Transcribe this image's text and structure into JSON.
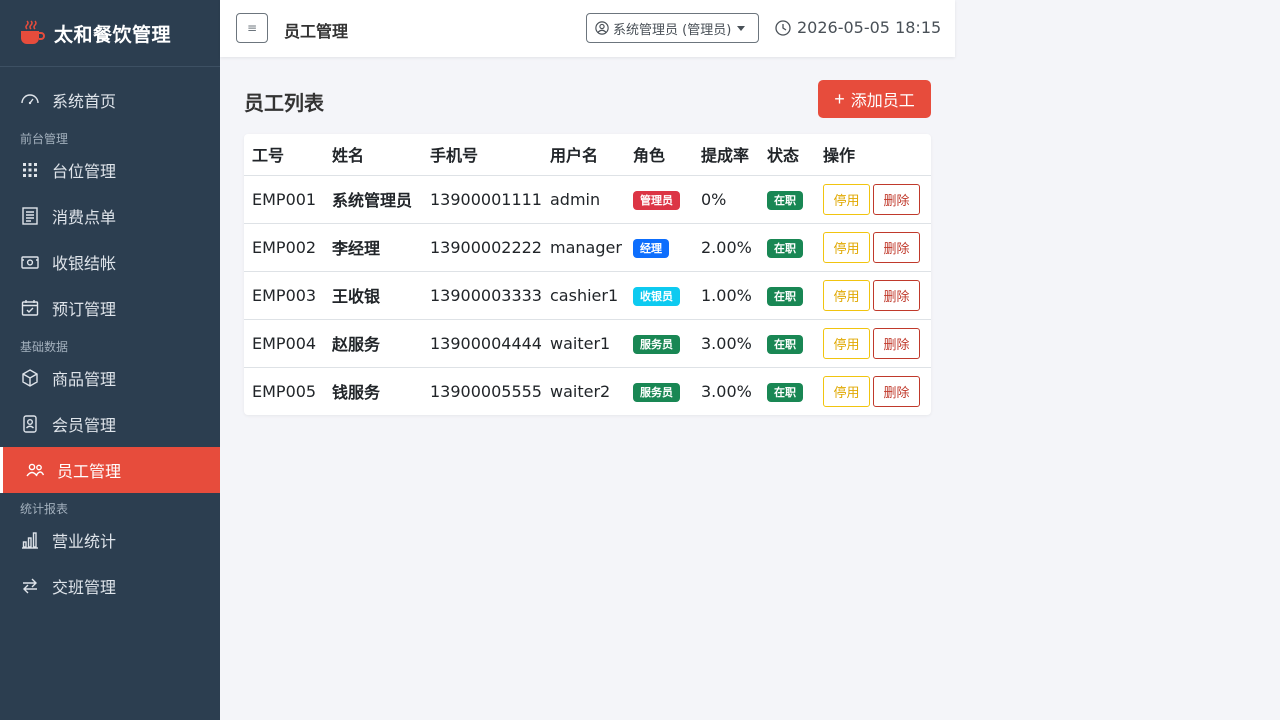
{
  "app": {
    "title": "太和餐饮管理"
  },
  "sidebar": {
    "items": [
      {
        "type": "item",
        "label": "系统首页",
        "icon": "dashboard-icon",
        "active": false
      },
      {
        "type": "section",
        "label": "前台管理"
      },
      {
        "type": "item",
        "label": "台位管理",
        "icon": "grid-icon",
        "active": false
      },
      {
        "type": "item",
        "label": "消费点单",
        "icon": "receipt-icon",
        "active": false
      },
      {
        "type": "item",
        "label": "收银结帐",
        "icon": "cash-icon",
        "active": false
      },
      {
        "type": "item",
        "label": "预订管理",
        "icon": "calendar-check-icon",
        "active": false
      },
      {
        "type": "section",
        "label": "基础数据"
      },
      {
        "type": "item",
        "label": "商品管理",
        "icon": "box-icon",
        "active": false
      },
      {
        "type": "item",
        "label": "会员管理",
        "icon": "member-card-icon",
        "active": false
      },
      {
        "type": "item",
        "label": "员工管理",
        "icon": "people-icon",
        "active": true
      },
      {
        "type": "section",
        "label": "统计报表"
      },
      {
        "type": "item",
        "label": "营业统计",
        "icon": "bar-chart-icon",
        "active": false
      },
      {
        "type": "item",
        "label": "交班管理",
        "icon": "swap-icon",
        "active": false
      }
    ]
  },
  "header": {
    "toggle_label": "≡",
    "page_title": "员工管理",
    "user_label": "系统管理员 (管理员)",
    "datetime": "2026-05-05 18:15"
  },
  "main": {
    "title": "员工列表",
    "add_button": "添加员工",
    "columns": [
      "工号",
      "姓名",
      "手机号",
      "用户名",
      "角色",
      "提成率",
      "状态",
      "操作"
    ],
    "rows": [
      {
        "id": "EMP001",
        "name": "系统管理员",
        "phone": "13900001111",
        "username": "admin",
        "role": "管理员",
        "role_color": "#dc3545",
        "commission": "0%",
        "status": "在职",
        "btn_disable": "停用",
        "btn_delete": "删除"
      },
      {
        "id": "EMP002",
        "name": "李经理",
        "phone": "13900002222",
        "username": "manager",
        "role": "经理",
        "role_color": "#0d6efd",
        "commission": "2.00%",
        "status": "在职",
        "btn_disable": "停用",
        "btn_delete": "删除"
      },
      {
        "id": "EMP003",
        "name": "王收银",
        "phone": "13900003333",
        "username": "cashier1",
        "role": "收银员",
        "role_color": "#0dcaf0",
        "commission": "1.00%",
        "status": "在职",
        "btn_disable": "停用",
        "btn_delete": "删除"
      },
      {
        "id": "EMP004",
        "name": "赵服务",
        "phone": "13900004444",
        "username": "waiter1",
        "role": "服务员",
        "role_color": "#198754",
        "commission": "3.00%",
        "status": "在职",
        "btn_disable": "停用",
        "btn_delete": "删除"
      },
      {
        "id": "EMP005",
        "name": "钱服务",
        "phone": "13900005555",
        "username": "waiter2",
        "role": "服务员",
        "role_color": "#198754",
        "commission": "3.00%",
        "status": "在职",
        "btn_disable": "停用",
        "btn_delete": "删除"
      }
    ],
    "status_color": "#198754"
  },
  "colors": {
    "sidebar_bg": "#2c3e50",
    "accent": "#e74c3c",
    "page_bg": "#f4f5f9"
  }
}
